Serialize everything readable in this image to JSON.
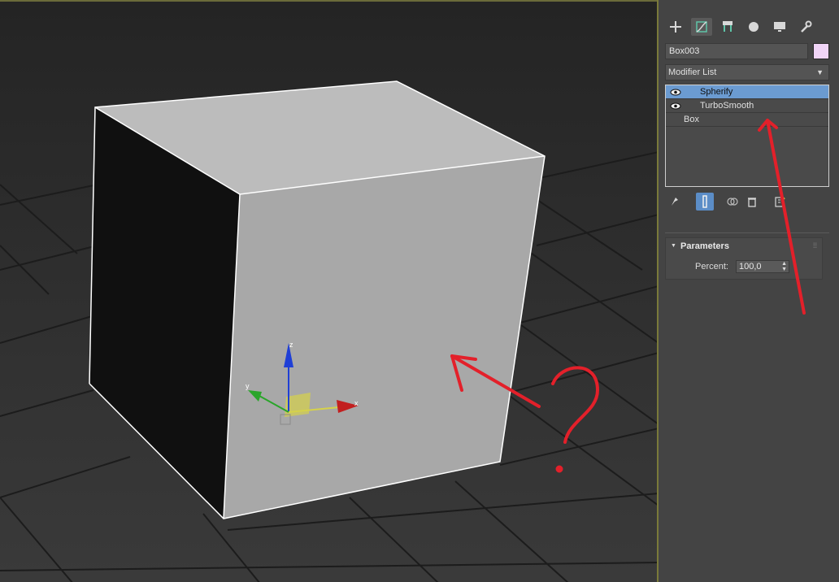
{
  "command_panel": {
    "tabs": [
      {
        "icon": "create-icon",
        "active": false
      },
      {
        "icon": "modify-icon",
        "active": true
      },
      {
        "icon": "hierarchy-icon",
        "active": false
      },
      {
        "icon": "motion-icon",
        "active": false
      },
      {
        "icon": "display-icon",
        "active": false
      },
      {
        "icon": "utilities-icon",
        "active": false
      }
    ],
    "object_name": "Box003",
    "object_color": "#f0d4f6",
    "modifier_list_label": "Modifier List",
    "modifier_stack": [
      {
        "label": "Spherify",
        "selected": true,
        "has_eye": true
      },
      {
        "label": "TurboSmooth",
        "selected": false,
        "has_eye": true
      },
      {
        "label": "Box",
        "selected": false,
        "has_eye": false
      }
    ],
    "parameters": {
      "title": "Parameters",
      "percent_label": "Percent:",
      "percent_value": "100,0"
    }
  },
  "viewport": {
    "gizmo_axes": {
      "x": "x",
      "y": "y",
      "z": "z"
    },
    "annotation_color": "#e3202a"
  },
  "colors": {
    "selection": "#6b9bd1",
    "panel_bg": "#444444",
    "accent_blue": "#5b8dc7"
  }
}
